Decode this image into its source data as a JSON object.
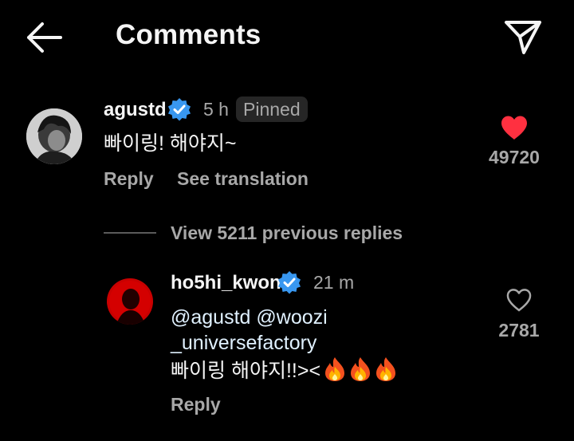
{
  "header": {
    "title": "Comments",
    "back_icon": "arrow-left-icon",
    "share_icon": "paper-plane-icon"
  },
  "comments": [
    {
      "username": "agustd",
      "verified": true,
      "time": "5 h",
      "badge": "Pinned",
      "text": "빠이링! 해야지~",
      "actions": {
        "reply": "Reply",
        "translate": "See translation"
      },
      "likes": "49720",
      "liked": true,
      "like_color": "#ff3040"
    }
  ],
  "replies_toggle": "View 5211 previous replies",
  "replies": [
    {
      "username": "ho5hi_kwon",
      "verified": true,
      "time": "21 m",
      "text_line1": "@agustd @woozi",
      "text_line2": "_universefactory",
      "text_line3": "빠이링 해야지!!><",
      "emoji": [
        "fire-emoji",
        "fire-emoji",
        "fire-emoji"
      ],
      "actions": {
        "reply": "Reply"
      },
      "likes": "2781",
      "liked": false
    }
  ],
  "colors": {
    "background": "#000000",
    "primary_text": "#f5f5f5",
    "secondary_text": "#a8a8a8",
    "verified_blue": "#3897f0",
    "like_red": "#ff3040"
  }
}
